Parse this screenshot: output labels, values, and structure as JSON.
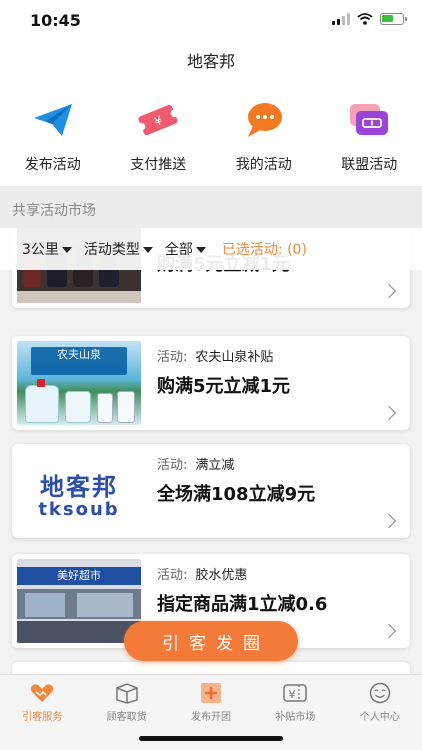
{
  "status": {
    "time": "10:45"
  },
  "nav": {
    "title": "地客邦"
  },
  "quick_menu": [
    {
      "label": "发布活动",
      "icon": "paper-plane-icon"
    },
    {
      "label": "支付推送",
      "icon": "ticket-icon"
    },
    {
      "label": "我的活动",
      "icon": "chat-bubble-icon"
    },
    {
      "label": "联盟活动",
      "icon": "coupon-icon"
    }
  ],
  "section": {
    "title": "共享活动市场"
  },
  "filters": {
    "distance": "3公里",
    "type": "活动类型",
    "scope": "全部",
    "selected": "已选活动: (0)"
  },
  "cards": [
    {
      "kind_prefix": "",
      "kind_name": "",
      "title": "购满5元立减1元"
    },
    {
      "kind_prefix": "活动:",
      "kind_name": "农夫山泉补贴",
      "title": "购满5元立减1元",
      "thumb_text": "农夫山泉"
    },
    {
      "kind_prefix": "活动:",
      "kind_name": "满立减",
      "title": "全场满108立减9元",
      "thumb_text": "地客邦",
      "thumb_sub": "tksoub"
    },
    {
      "kind_prefix": "活动:",
      "kind_name": "胶水优惠",
      "title": "指定商品满1立减0.6",
      "thumb_text": "美好超市"
    }
  ],
  "fab": {
    "label": "引客发圈"
  },
  "tabs": [
    {
      "label": "引客服务",
      "icon": "handshake-icon",
      "active": true
    },
    {
      "label": "顾客取货",
      "icon": "box-icon",
      "active": false
    },
    {
      "label": "发布开团",
      "icon": "plus-square-icon",
      "active": false
    },
    {
      "label": "补贴市场",
      "icon": "yuan-ticket-icon",
      "active": false
    },
    {
      "label": "个人中心",
      "icon": "smiley-icon",
      "active": false
    }
  ],
  "colors": {
    "accent": "#f08a3a",
    "fab": "#f47a3a"
  }
}
